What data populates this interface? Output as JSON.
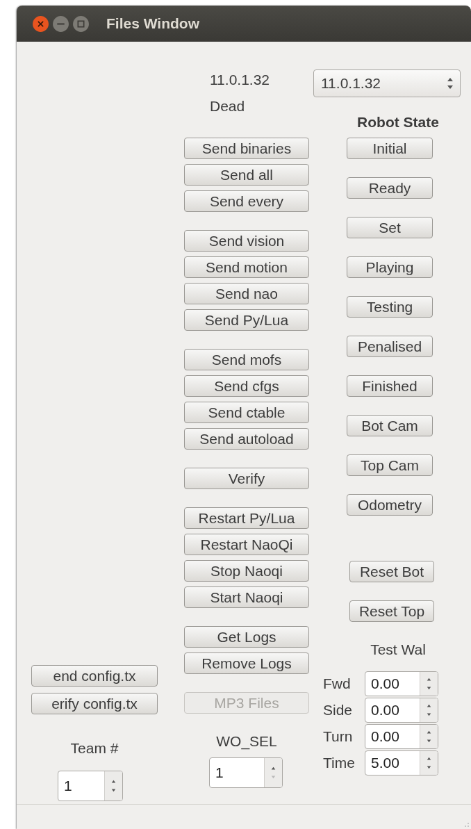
{
  "window": {
    "title": "Files Window"
  },
  "robot": {
    "address": "11.0.1.32",
    "status": "Dead"
  },
  "robot_select": {
    "value": "11.0.1.32"
  },
  "file_button_groups": [
    [
      {
        "label": "Send binaries",
        "disabled": false
      },
      {
        "label": "Send all",
        "disabled": false
      },
      {
        "label": "Send every",
        "disabled": false
      }
    ],
    [
      {
        "label": "Send vision",
        "disabled": false
      },
      {
        "label": "Send motion",
        "disabled": false
      },
      {
        "label": "Send nao",
        "disabled": false
      },
      {
        "label": "Send Py/Lua",
        "disabled": false
      }
    ],
    [
      {
        "label": "Send mofs",
        "disabled": false
      },
      {
        "label": "Send cfgs",
        "disabled": false
      },
      {
        "label": "Send ctable",
        "disabled": false
      },
      {
        "label": "Send autoload",
        "disabled": false
      }
    ],
    [
      {
        "label": "Verify",
        "disabled": false
      }
    ],
    [
      {
        "label": "Restart Py/Lua",
        "disabled": false
      },
      {
        "label": "Restart NaoQi",
        "disabled": false
      },
      {
        "label": "Stop Naoqi",
        "disabled": false
      },
      {
        "label": "Start Naoqi",
        "disabled": false
      }
    ],
    [
      {
        "label": "Get Logs",
        "disabled": false
      },
      {
        "label": "Remove Logs",
        "disabled": false
      }
    ],
    [
      {
        "label": "MP3 Files",
        "disabled": true
      }
    ]
  ],
  "robot_state": {
    "title": "Robot State",
    "buttons": [
      "Initial",
      "Ready",
      "Set",
      "Playing",
      "Testing",
      "Penalised",
      "Finished",
      "Bot Cam",
      "Top Cam",
      "Odometry"
    ]
  },
  "camera_reset_buttons": [
    "Reset Bot",
    "Reset Top"
  ],
  "test_walk": {
    "title": "Test Wal",
    "fields": [
      {
        "label": "Fwd",
        "value": "0.00"
      },
      {
        "label": "Side",
        "value": "0.00"
      },
      {
        "label": "Turn",
        "value": "0.00"
      },
      {
        "label": "Time",
        "value": "5.00"
      }
    ]
  },
  "config_buttons": [
    "end config.tx",
    "erify config.tx"
  ],
  "team": {
    "label": "Team #",
    "value": "1"
  },
  "wo_self": {
    "label": "WO_SEL",
    "value": "1"
  }
}
